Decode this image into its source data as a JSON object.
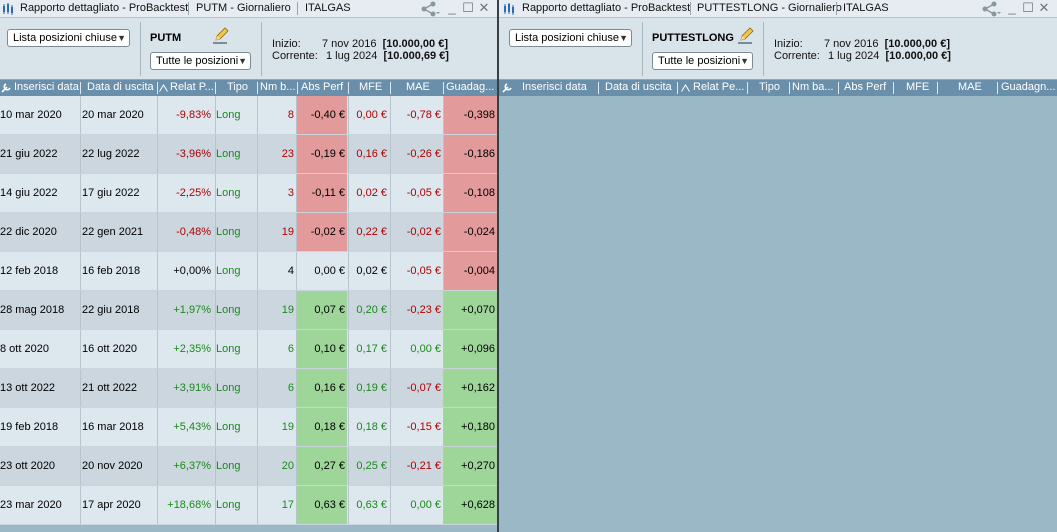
{
  "left": {
    "title_tabs": [
      "Rapporto dettagliato - ProBacktest",
      "PUTM - Giornaliero",
      "ITALGAS"
    ],
    "list_select": "Lista posizioni chiuse",
    "symbol": "PUTM",
    "filter_select": "Tutte le posizioni",
    "start_label": "Inizio:",
    "start_date": "7 nov 2016",
    "start_value": "[10.000,00 €]",
    "current_label": "Corrente:",
    "current_date": "1 lug 2024",
    "current_value": "[10.000,69 €]",
    "columns": [
      "Inserisci data",
      "Data di uscita",
      "Relat P...",
      "Tipo",
      "Nm b...",
      "Abs Perf",
      "MFE",
      "MAE",
      "Guadag..."
    ],
    "rows": [
      {
        "entry": "10 mar 2020",
        "exit": "20 mar 2020",
        "relat": "-9,83%",
        "type": "Long",
        "nb": "8",
        "abs": "-0,40 €",
        "mfe": "0,00 €",
        "mae": "-0,78 €",
        "gain": "-0,398"
      },
      {
        "entry": "21 giu 2022",
        "exit": "22 lug 2022",
        "relat": "-3,96%",
        "type": "Long",
        "nb": "23",
        "abs": "-0,19 €",
        "mfe": "0,16 €",
        "mae": "-0,26 €",
        "gain": "-0,186"
      },
      {
        "entry": "14 giu 2022",
        "exit": "17 giu 2022",
        "relat": "-2,25%",
        "type": "Long",
        "nb": "3",
        "abs": "-0,11 €",
        "mfe": "0,02 €",
        "mae": "-0,05 €",
        "gain": "-0,108"
      },
      {
        "entry": "22 dic 2020",
        "exit": "22 gen 2021",
        "relat": "-0,48%",
        "type": "Long",
        "nb": "19",
        "abs": "-0,02 €",
        "mfe": "0,22 €",
        "mae": "-0,02 €",
        "gain": "-0,024"
      },
      {
        "entry": "12 feb 2018",
        "exit": "16 feb 2018",
        "relat": "+0,00%",
        "type": "Long",
        "nb": "4",
        "abs": "0,00 €",
        "mfe": "0,02 €",
        "mae": "-0,05 €",
        "gain": "-0,004"
      },
      {
        "entry": "28 mag 2018",
        "exit": "22 giu 2018",
        "relat": "+1,97%",
        "type": "Long",
        "nb": "19",
        "abs": "0,07 €",
        "mfe": "0,20 €",
        "mae": "-0,23 €",
        "gain": "+0,070"
      },
      {
        "entry": "8 ott 2020",
        "exit": "16 ott 2020",
        "relat": "+2,35%",
        "type": "Long",
        "nb": "6",
        "abs": "0,10 €",
        "mfe": "0,17 €",
        "mae": "0,00 €",
        "gain": "+0,096"
      },
      {
        "entry": "13 ott 2022",
        "exit": "21 ott 2022",
        "relat": "+3,91%",
        "type": "Long",
        "nb": "6",
        "abs": "0,16 €",
        "mfe": "0,19 €",
        "mae": "-0,07 €",
        "gain": "+0,162"
      },
      {
        "entry": "19 feb 2018",
        "exit": "16 mar 2018",
        "relat": "+5,43%",
        "type": "Long",
        "nb": "19",
        "abs": "0,18 €",
        "mfe": "0,18 €",
        "mae": "-0,15 €",
        "gain": "+0,180"
      },
      {
        "entry": "23 ott 2020",
        "exit": "20 nov 2020",
        "relat": "+6,37%",
        "type": "Long",
        "nb": "20",
        "abs": "0,27 €",
        "mfe": "0,25 €",
        "mae": "-0,21 €",
        "gain": "+0,270"
      },
      {
        "entry": "23 mar 2020",
        "exit": "17 apr 2020",
        "relat": "+18,68%",
        "type": "Long",
        "nb": "17",
        "abs": "0,63 €",
        "mfe": "0,63 €",
        "mae": "0,00 €",
        "gain": "+0,628"
      }
    ]
  },
  "right": {
    "title_tabs": [
      "Rapporto dettagliato - ProBacktest",
      "PUTTESTLONG - Giornaliero",
      "ITALGAS"
    ],
    "list_select": "Lista posizioni chiuse",
    "symbol": "PUTTESTLONG",
    "filter_select": "Tutte le posizioni",
    "start_label": "Inizio:",
    "start_date": "7 nov 2016",
    "start_value": "[10.000,00 €]",
    "current_label": "Corrente:",
    "current_date": "1 lug 2024",
    "current_value": "[10.000,00 €]",
    "columns": [
      "Inserisci data",
      "Data di uscita",
      "Relat Pe...",
      "Tipo",
      "Nm ba...",
      "Abs Perf",
      "MFE",
      "MAE",
      "Guadagn..."
    ]
  },
  "icons": {
    "app": "candlestick-icon",
    "share": "share-icon",
    "minimize": "minimize-icon",
    "maximize": "maximize-icon",
    "close": "close-icon",
    "edit": "pencil-icon",
    "settings": "wrench-icon",
    "sort": "sort-up-icon"
  },
  "colors": {
    "negative_text": "#b00000",
    "positive_text": "#1b8a1b",
    "negative_bg": "#e29a9a",
    "positive_bg": "#9ed69a",
    "header_bg": "#6a8fab"
  }
}
